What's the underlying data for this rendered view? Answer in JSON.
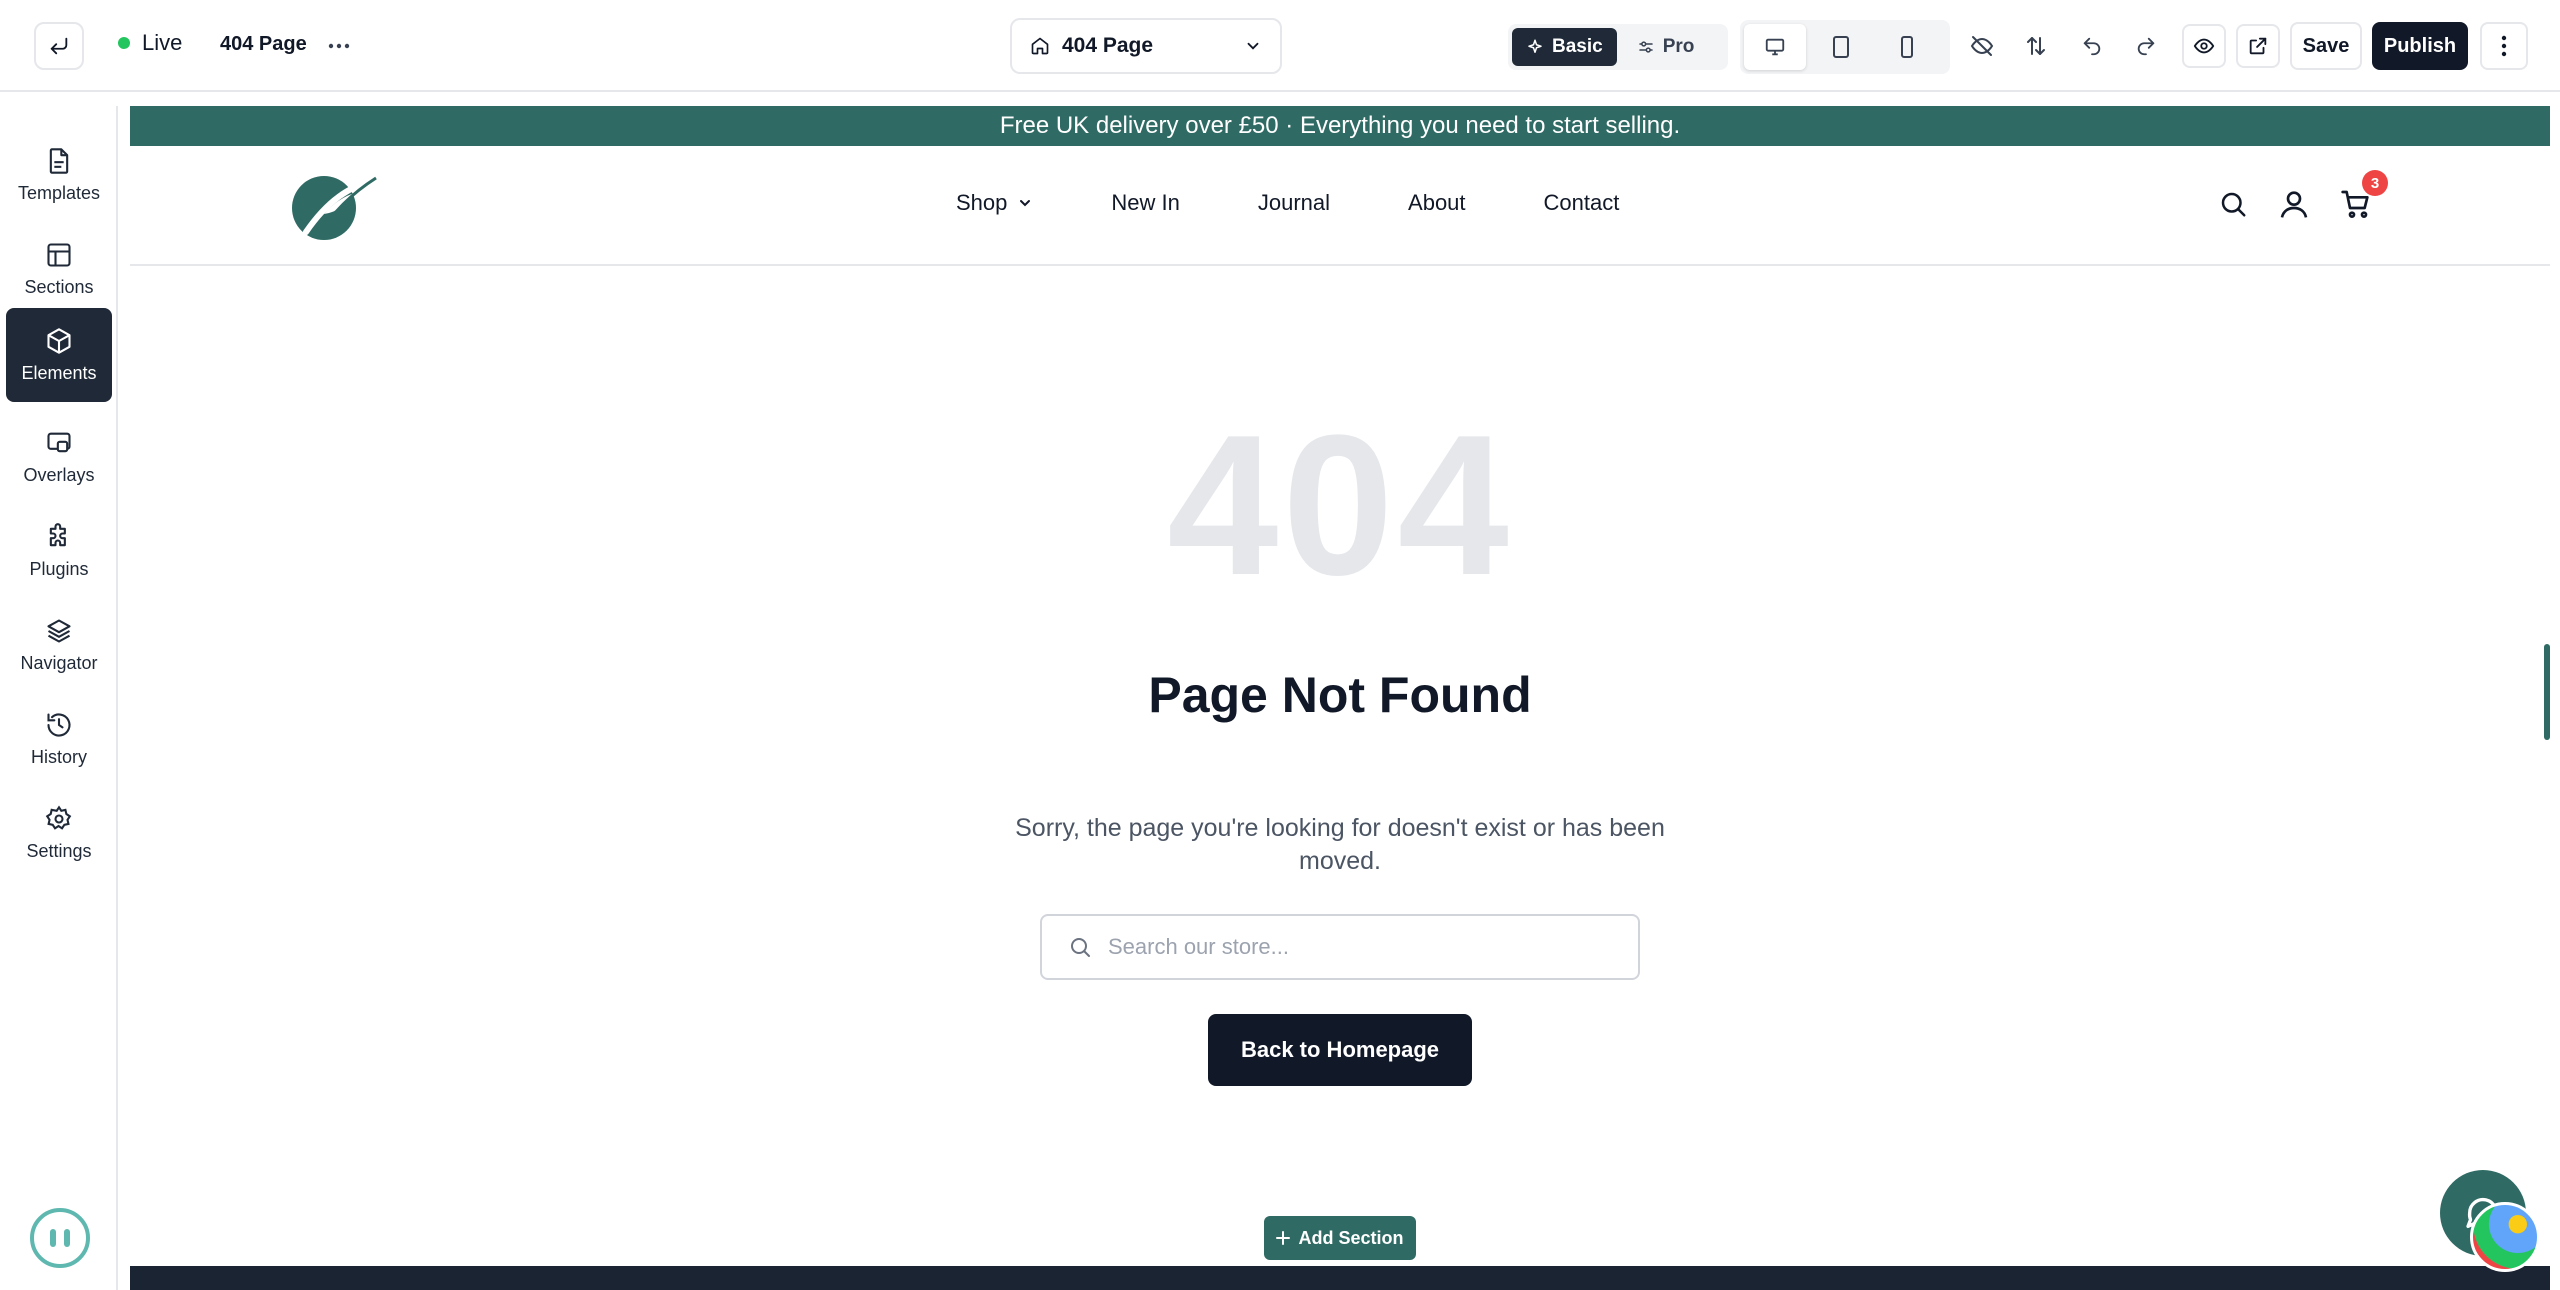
{
  "topbar": {
    "status_label": "Live",
    "page_name": "404 Page",
    "page_select_value": "404 Page",
    "modes": [
      "Basic",
      "Pro"
    ],
    "active_mode": "Basic",
    "save_label": "Save",
    "publish_label": "Publish"
  },
  "sidebar": {
    "items": [
      {
        "label": "Templates",
        "icon": "file-icon"
      },
      {
        "label": "Sections",
        "icon": "layout-icon"
      },
      {
        "label": "Elements",
        "icon": "cube-icon",
        "active": true
      },
      {
        "label": "Overlays",
        "icon": "overlay-icon"
      },
      {
        "label": "Plugins",
        "icon": "puzzle-icon"
      },
      {
        "label": "Navigator",
        "icon": "layers-icon"
      },
      {
        "label": "History",
        "icon": "history-icon"
      },
      {
        "label": "Settings",
        "icon": "gear-icon"
      }
    ]
  },
  "site": {
    "announcement": "Free UK delivery over £50 · Everything you need to start selling.",
    "nav": [
      "Shop",
      "New In",
      "Journal",
      "About",
      "Contact"
    ],
    "cart_count": "3",
    "brand_color": "#2f6b64"
  },
  "error_page": {
    "code": "404",
    "title": "Page Not Found",
    "message": "Sorry, the page you're looking for doesn't exist or has been moved.",
    "search_placeholder": "Search our store...",
    "home_button": "Back to Homepage"
  },
  "canvas": {
    "add_section_label": "Add Section"
  }
}
